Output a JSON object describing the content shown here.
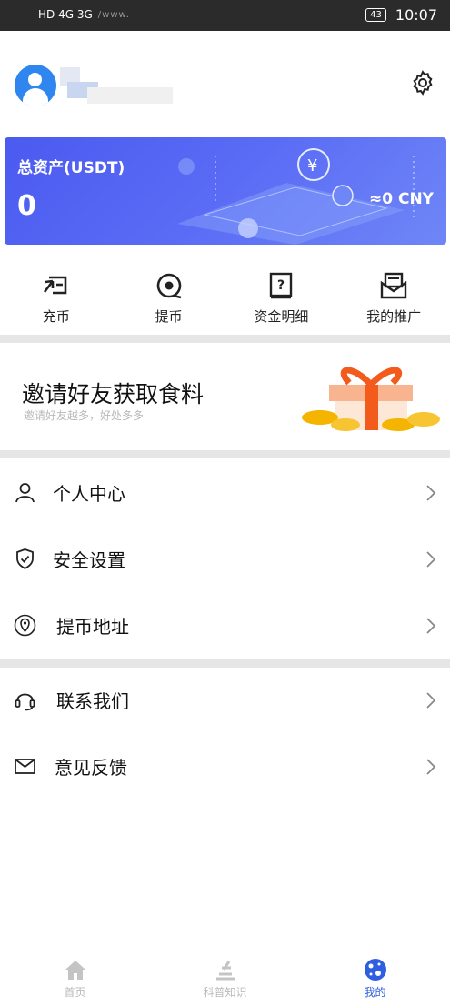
{
  "status_bar": {
    "left": "HD 4G 3G",
    "url_fragment": "/www.",
    "battery": "43",
    "time": "10:07"
  },
  "profile": {
    "username": ""
  },
  "asset_card": {
    "label": "总资产(USDT)",
    "value": "0",
    "cny": "≈0 CNY"
  },
  "actions": [
    {
      "label": "充币",
      "icon": "deposit-icon"
    },
    {
      "label": "提币",
      "icon": "withdraw-icon"
    },
    {
      "label": "资金明细",
      "icon": "ledger-icon"
    },
    {
      "label": "我的推广",
      "icon": "promotion-icon"
    }
  ],
  "invite": {
    "title": "邀请好友获取食料",
    "subtitle": "邀请好友越多，好处多多"
  },
  "menu_group_1": [
    {
      "label": "个人中心",
      "icon": "user-icon"
    },
    {
      "label": "安全设置",
      "icon": "shield-icon"
    },
    {
      "label": "提币地址",
      "icon": "location-icon"
    }
  ],
  "menu_group_2": [
    {
      "label": "联系我们",
      "icon": "headset-icon"
    },
    {
      "label": "意见反馈",
      "icon": "mail-icon"
    }
  ],
  "tabs": [
    {
      "label": "首页",
      "icon": "home-icon",
      "active": false
    },
    {
      "label": "科普知识",
      "icon": "knowledge-icon",
      "active": false
    },
    {
      "label": "我的",
      "icon": "profile-planet-icon",
      "active": true
    }
  ],
  "colors": {
    "accent": "#2f5fe0",
    "card": "#5363f2",
    "avatar": "#2f86ee"
  }
}
